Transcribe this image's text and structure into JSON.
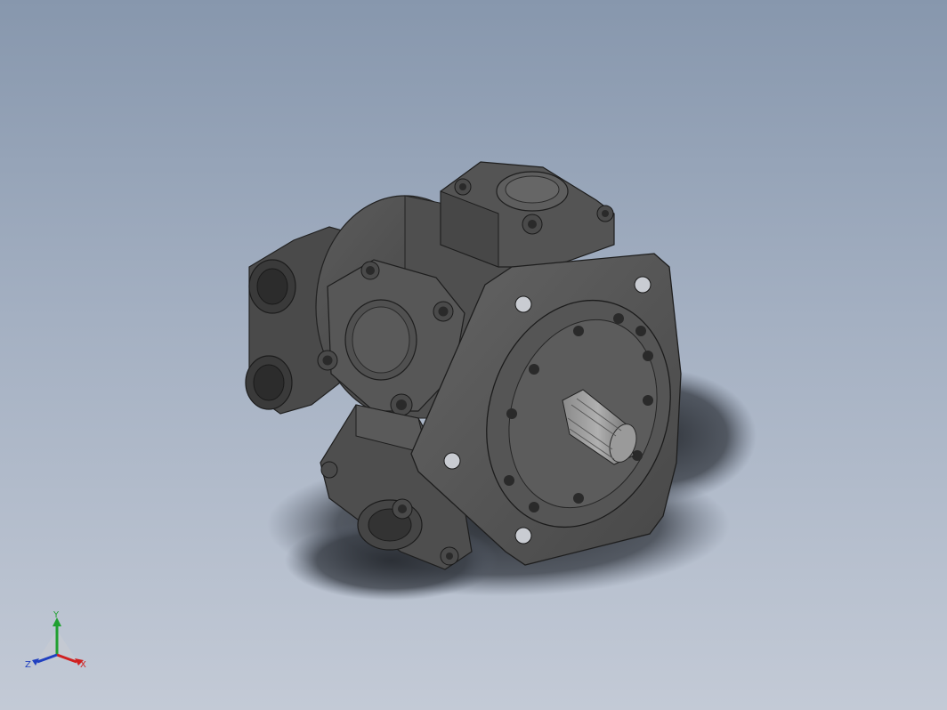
{
  "viewport": {
    "background_top": "#8797ad",
    "background_bottom": "#c3cad6",
    "model_color": "#4b4b4b",
    "shadow_color": "#2e3238"
  },
  "triad": {
    "x_label": "X",
    "y_label": "Y",
    "z_label": "Z",
    "x_color": "#d02020",
    "y_color": "#20a030",
    "z_color": "#2040c0"
  }
}
